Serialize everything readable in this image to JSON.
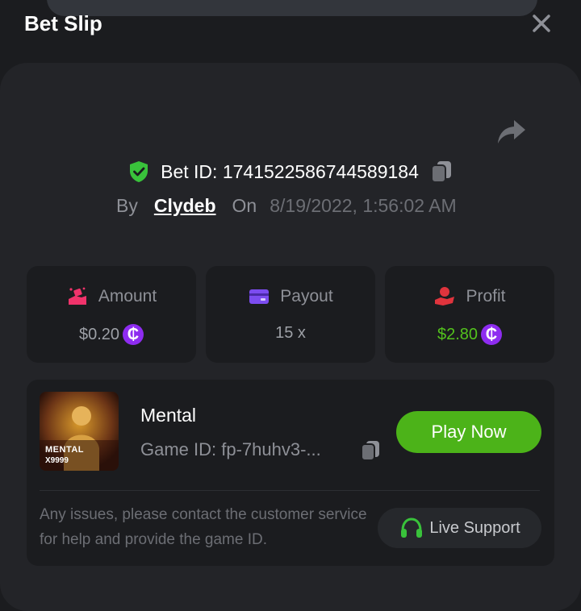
{
  "header": {
    "title": "Bet Slip"
  },
  "bet": {
    "id_text": "Bet ID: 1741522586744589184",
    "by_label": "By",
    "user": "Clydeb",
    "on_label": "On",
    "date": "8/19/2022, 1:56:02 AM"
  },
  "stats": {
    "amount": {
      "label": "Amount",
      "value": "$0.20"
    },
    "payout": {
      "label": "Payout",
      "value": "15 x"
    },
    "profit": {
      "label": "Profit",
      "value": "$2.80"
    }
  },
  "coin_symbol": "₵",
  "game": {
    "name": "Mental",
    "id_text": "Game ID: fp-7huhv3-...",
    "thumb_title": "MENTAL",
    "thumb_subtitle": "X9999",
    "play_label": "Play Now"
  },
  "support": {
    "info_text": "Any issues, please contact the customer service for help and provide the game ID.",
    "button_label": "Live Support"
  },
  "colors": {
    "background": "#1b1c1f",
    "card": "#232428",
    "accent_green": "#4cb319",
    "profit_green": "#53c21d",
    "coin_purple": "#8e2cf0",
    "amount_pink": "#f0336b",
    "payout_purple": "#7c4cf0",
    "profit_red": "#e0343d"
  },
  "icons": {
    "close": "close-icon",
    "share": "share-icon",
    "shield": "shield-check-icon",
    "copy": "copy-icon",
    "amount": "money-hand-icon",
    "payout": "card-icon",
    "profit": "hand-coin-icon",
    "support": "headset-icon"
  }
}
